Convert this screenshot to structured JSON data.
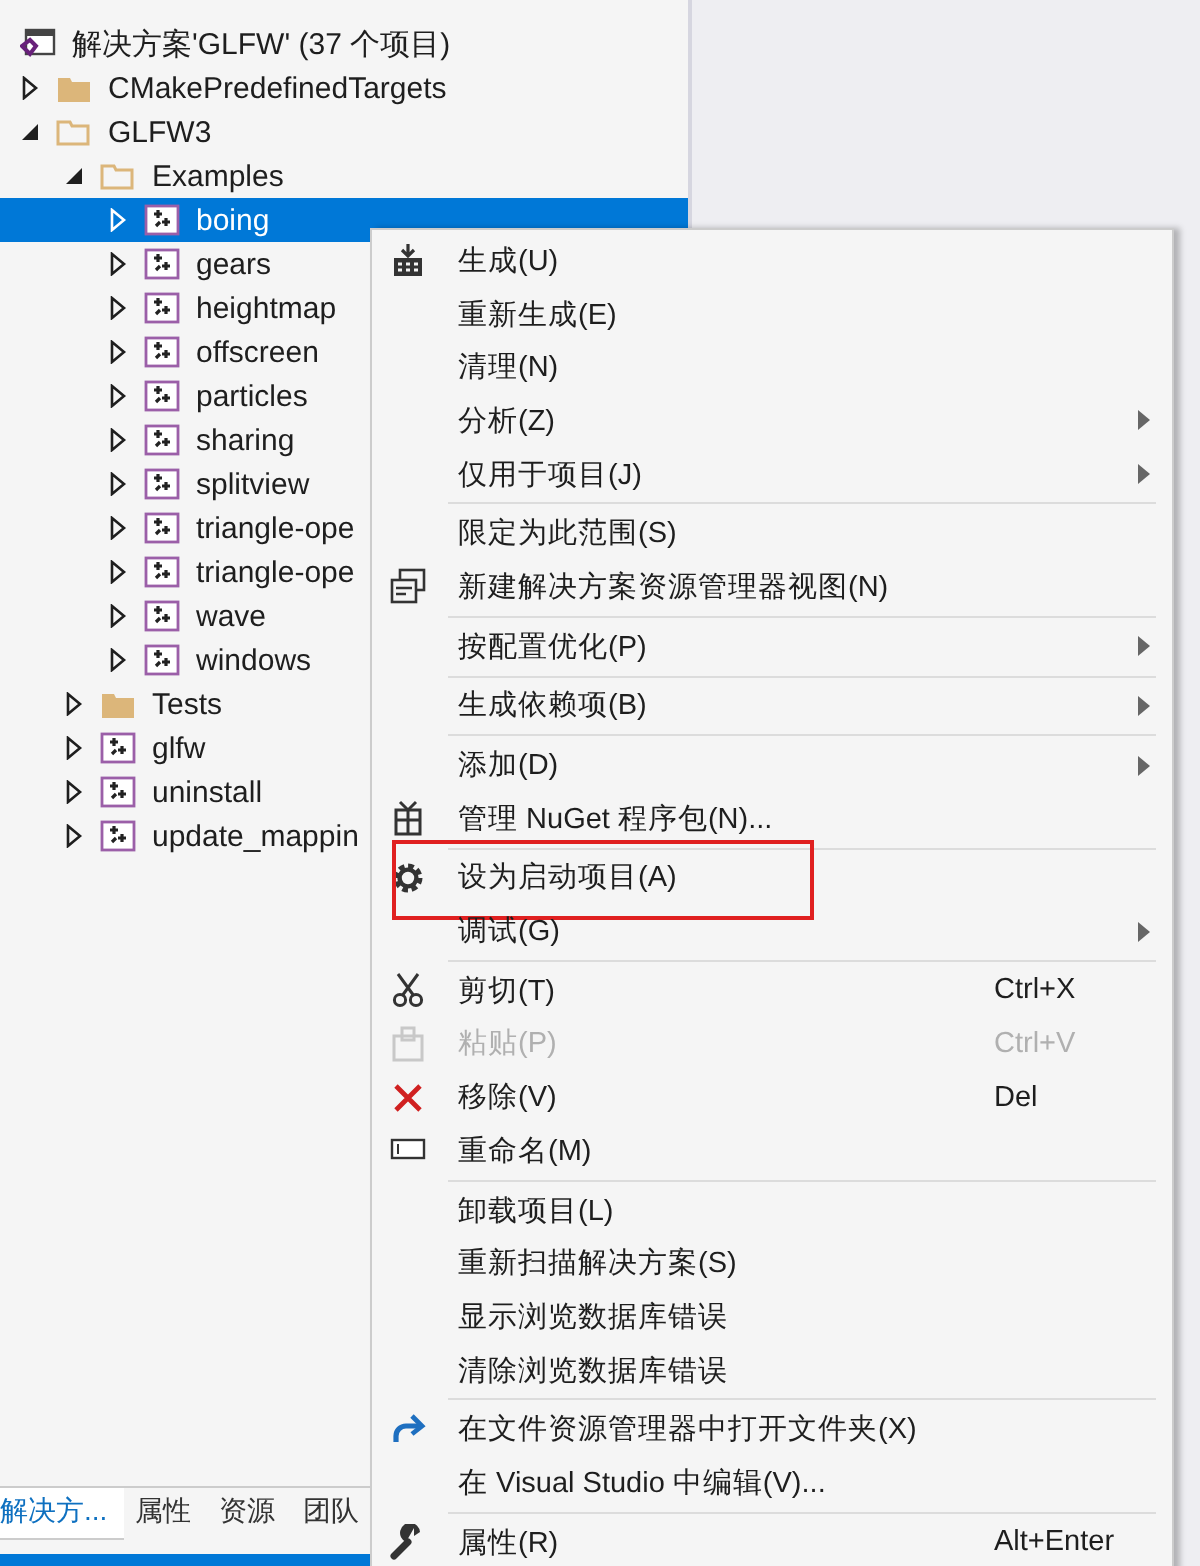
{
  "solution": {
    "title": "解决方案'GLFW' (37 个项目)"
  },
  "tree": [
    {
      "label": "CMakePredefinedTargets",
      "kind": "folder",
      "expanded": false,
      "selected": false
    },
    {
      "label": "GLFW3",
      "kind": "folder",
      "expanded": true,
      "selected": false,
      "children": [
        {
          "label": "Examples",
          "kind": "folder",
          "expanded": true,
          "selected": false,
          "children": [
            {
              "label": "boing",
              "kind": "project",
              "expanded": false,
              "selected": true
            },
            {
              "label": "gears",
              "kind": "project",
              "expanded": false,
              "selected": false
            },
            {
              "label": "heightmap",
              "kind": "project",
              "expanded": false,
              "selected": false
            },
            {
              "label": "offscreen",
              "kind": "project",
              "expanded": false,
              "selected": false
            },
            {
              "label": "particles",
              "kind": "project",
              "expanded": false,
              "selected": false
            },
            {
              "label": "sharing",
              "kind": "project",
              "expanded": false,
              "selected": false
            },
            {
              "label": "splitview",
              "kind": "project",
              "expanded": false,
              "selected": false
            },
            {
              "label": "triangle-ope",
              "kind": "project",
              "expanded": false,
              "selected": false
            },
            {
              "label": "triangle-ope",
              "kind": "project",
              "expanded": false,
              "selected": false
            },
            {
              "label": "wave",
              "kind": "project",
              "expanded": false,
              "selected": false
            },
            {
              "label": "windows",
              "kind": "project",
              "expanded": false,
              "selected": false
            }
          ]
        },
        {
          "label": "Tests",
          "kind": "folder",
          "expanded": false,
          "selected": false
        },
        {
          "label": "glfw",
          "kind": "project",
          "expanded": false,
          "selected": false
        },
        {
          "label": "uninstall",
          "kind": "project",
          "expanded": false,
          "selected": false
        },
        {
          "label": "update_mappin",
          "kind": "project",
          "expanded": false,
          "selected": false
        }
      ]
    }
  ],
  "bottom_tabs": [
    {
      "label": "解决方...",
      "selected": true
    },
    {
      "label": "属性",
      "selected": false
    },
    {
      "label": "资源",
      "selected": false
    },
    {
      "label": "团队",
      "selected": false
    }
  ],
  "context_menu": [
    {
      "kind": "build",
      "label": "生成(U)"
    },
    {
      "kind": "item",
      "label": "重新生成(E)"
    },
    {
      "kind": "item",
      "label": "清理(N)"
    },
    {
      "kind": "item",
      "label": "分析(Z)",
      "submenu": true
    },
    {
      "kind": "item",
      "label": "仅用于项目(J)",
      "submenu": true
    },
    {
      "kind": "separator"
    },
    {
      "kind": "item",
      "label": "限定为此范围(S)"
    },
    {
      "kind": "windows",
      "label": "新建解决方案资源管理器视图(N)"
    },
    {
      "kind": "separator"
    },
    {
      "kind": "item",
      "label": "按配置优化(P)",
      "submenu": true
    },
    {
      "kind": "separator"
    },
    {
      "kind": "item",
      "label": "生成依赖项(B)",
      "submenu": true
    },
    {
      "kind": "separator"
    },
    {
      "kind": "item",
      "label": "添加(D)",
      "submenu": true
    },
    {
      "kind": "gift",
      "label": "管理 NuGet 程序包(N)..."
    },
    {
      "kind": "separator"
    },
    {
      "kind": "gear",
      "label": "设为启动项目(A)",
      "annotated": true
    },
    {
      "kind": "item",
      "label": "调试(G)",
      "submenu": true
    },
    {
      "kind": "separator"
    },
    {
      "kind": "scissors",
      "label": "剪切(T)",
      "shortcut": "Ctrl+X"
    },
    {
      "kind": "paste",
      "label": "粘贴(P)",
      "shortcut": "Ctrl+V",
      "disabled": true
    },
    {
      "kind": "remove",
      "label": "移除(V)",
      "shortcut": "Del"
    },
    {
      "kind": "rename",
      "label": "重命名(M)"
    },
    {
      "kind": "separator"
    },
    {
      "kind": "item",
      "label": "卸载项目(L)"
    },
    {
      "kind": "item",
      "label": "重新扫描解决方案(S)"
    },
    {
      "kind": "item",
      "label": "显示浏览数据库错误"
    },
    {
      "kind": "item",
      "label": "清除浏览数据库错误"
    },
    {
      "kind": "separator"
    },
    {
      "kind": "redo",
      "label": "在文件资源管理器中打开文件夹(X)"
    },
    {
      "kind": "item",
      "label": "在 Visual Studio 中编辑(V)..."
    },
    {
      "kind": "separator"
    },
    {
      "kind": "wrench",
      "label": "属性(R)",
      "shortcut": "Alt+Enter"
    }
  ]
}
